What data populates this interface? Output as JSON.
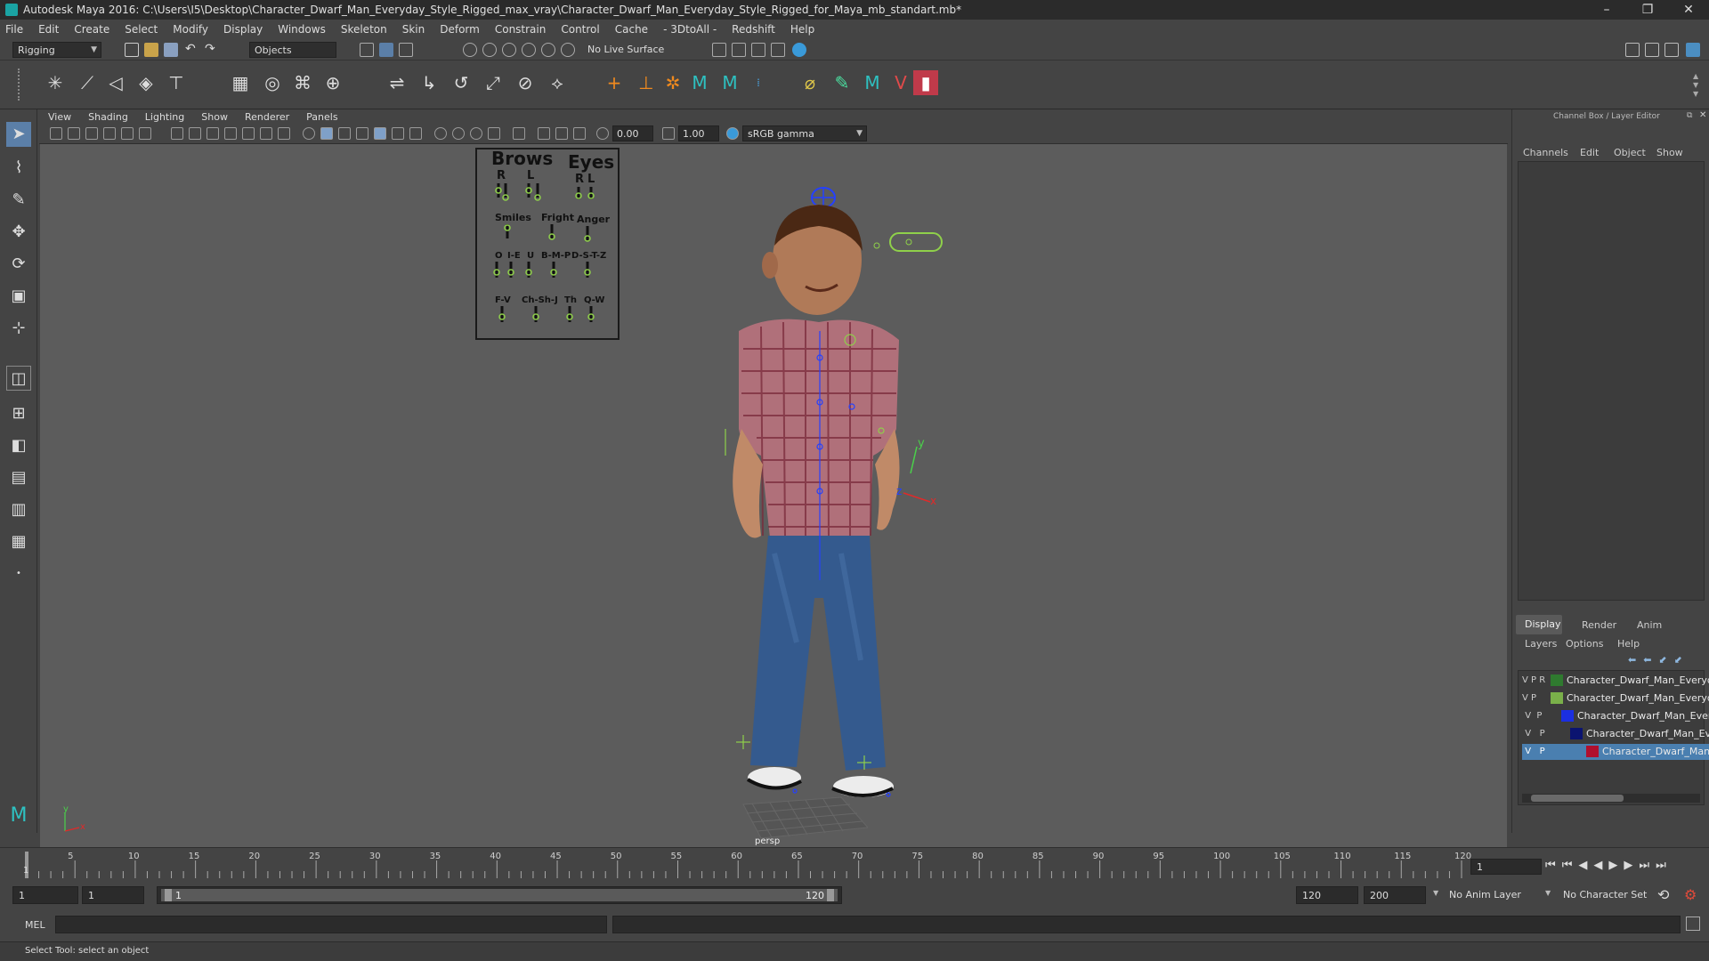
{
  "window": {
    "title": "Autodesk Maya 2016: C:\\Users\\I5\\Desktop\\Character_Dwarf_Man_Everyday_Style_Rigged_max_vray\\Character_Dwarf_Man_Everyday_Style_Rigged_for_Maya_mb_standart.mb*",
    "minimize": "–",
    "maximize": "❐",
    "close": "✕"
  },
  "menubar": {
    "items": [
      "File",
      "Edit",
      "Create",
      "Select",
      "Modify",
      "Display",
      "Windows",
      "Skeleton",
      "Skin",
      "Deform",
      "Constrain",
      "Control",
      "Cache",
      "- 3DtoAll -",
      "Redshift",
      "Help"
    ]
  },
  "statusline": {
    "menuset": "Rigging",
    "selection_mode": "Objects",
    "live_surface": "No Live Surface"
  },
  "viewport": {
    "menu": [
      "View",
      "Shading",
      "Lighting",
      "Show",
      "Renderer",
      "Panels"
    ],
    "near_value": "0.00",
    "far_value": "1.00",
    "color_space": "sRGB gamma",
    "camera_label": "persp",
    "face_panel": {
      "brows": "Brows",
      "eyes": "Eyes",
      "r1": "R",
      "l1": "L",
      "r2": "R",
      "l2": "L",
      "smiles": "Smiles",
      "fright": "Fright",
      "anger": "Anger",
      "o": "O",
      "ie": "I-E",
      "u": "U",
      "bmp": "B-M-P",
      "dstz": "D-S-T-Z",
      "fv": "F-V",
      "chshj": "Ch-Sh-J",
      "th": "Th",
      "qw": "Q-W"
    },
    "axis_y": "y",
    "axis_x": "x",
    "gizmo_y": "y",
    "gizmo_z": "z",
    "gizmo_x": "x"
  },
  "channel_box": {
    "header": "Channel Box / Layer Editor",
    "menu": [
      "Channels",
      "Edit",
      "Object",
      "Show"
    ],
    "tabs": [
      "Display",
      "Render",
      "Anim"
    ],
    "layer_menu": [
      "Layers",
      "Options",
      "Help"
    ],
    "layers": [
      {
        "v": "V",
        "p": "P",
        "r": "R",
        "color": "#2f7a2f",
        "name": "Character_Dwarf_Man_Everyday"
      },
      {
        "v": "V",
        "p": "P",
        "r": "",
        "color": "#7ab04a",
        "name": "Character_Dwarf_Man_Everyday"
      },
      {
        "v": "V",
        "p": "P",
        "r": "",
        "color": "#1b2fe0",
        "name": "Character_Dwarf_Man_Every"
      },
      {
        "v": "V",
        "p": "P",
        "r": "",
        "color": "#0b1470",
        "name": "Character_Dwarf_Man_Ev"
      },
      {
        "v": "V",
        "p": "P",
        "r": "",
        "color": "#b0102e",
        "name": "Character_Dwarf_Man"
      }
    ]
  },
  "timeline": {
    "ticks": [
      "5",
      "10",
      "15",
      "20",
      "25",
      "30",
      "35",
      "40",
      "45",
      "50",
      "55",
      "60",
      "65",
      "70",
      "75",
      "80",
      "85",
      "90",
      "95",
      "100",
      "105",
      "110",
      "115",
      "120"
    ],
    "first_tick": "1",
    "current_frame": "1"
  },
  "range": {
    "start": "1",
    "playback_start": "1",
    "slider_start": "1",
    "slider_end": "120",
    "playback_end": "120",
    "end": "200",
    "anim_layer": "No Anim Layer",
    "character_set": "No Character Set"
  },
  "cmdline": {
    "label": "MEL"
  },
  "helpline": {
    "text": "Select Tool: select an object"
  }
}
